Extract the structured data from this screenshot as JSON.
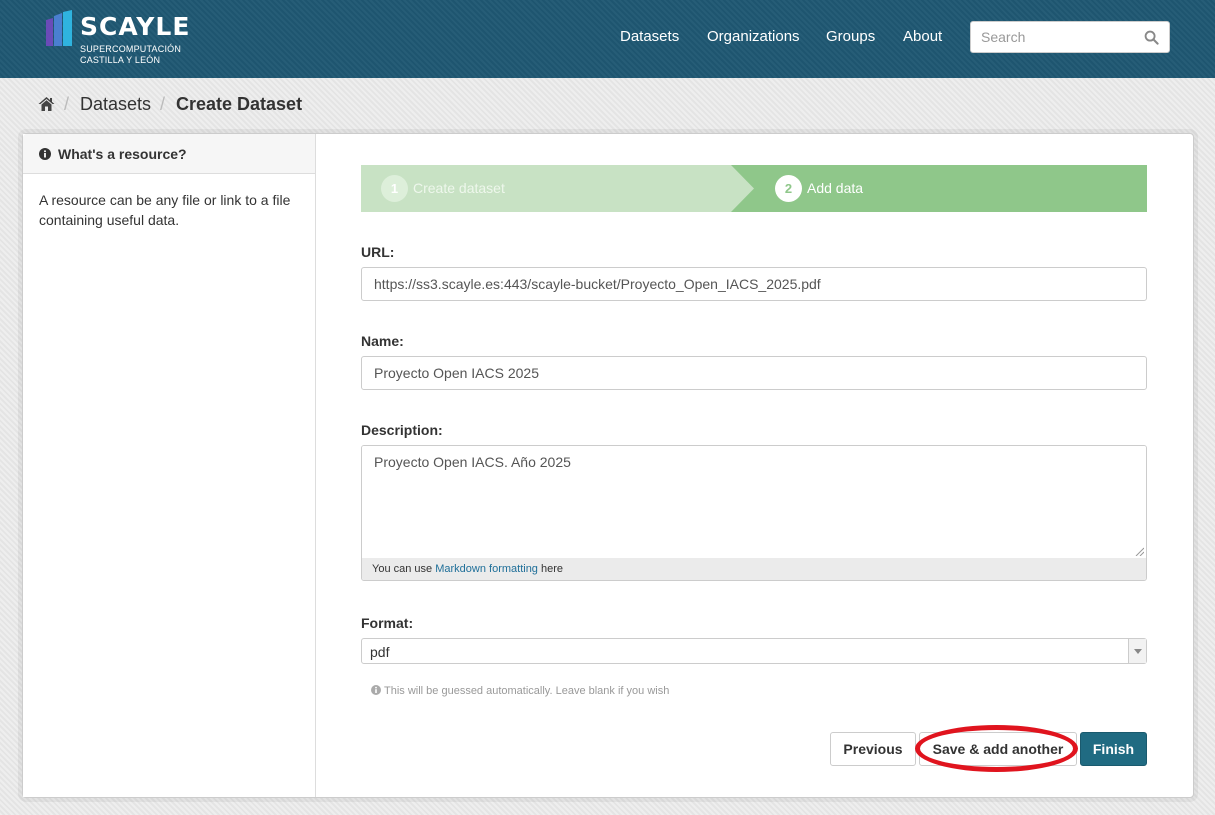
{
  "brand": {
    "name": "SCAYLE",
    "subtitle_line1": "SUPERCOMPUTACIÓN",
    "subtitle_line2": "CASTILLA Y LEÓN",
    "colors": {
      "header_bg": "#1f5873",
      "mark_left": "#5b3fa8",
      "mark_right": "#2ea8d8"
    }
  },
  "nav": {
    "items": [
      {
        "label": "Datasets"
      },
      {
        "label": "Organizations"
      },
      {
        "label": "Groups"
      },
      {
        "label": "About"
      }
    ],
    "search": {
      "placeholder": "Search",
      "icon": "search-icon"
    }
  },
  "breadcrumb": {
    "home_icon": "home-icon",
    "items": [
      {
        "label": "Datasets"
      }
    ],
    "active": "Create Dataset"
  },
  "sidebar": {
    "title": "What's a resource?",
    "icon": "info-circle-icon",
    "text": "A resource can be any file or link to a file containing useful data."
  },
  "stages": [
    {
      "number": "1",
      "label": "Create dataset",
      "state": "complete"
    },
    {
      "number": "2",
      "label": "Add data",
      "state": "active"
    }
  ],
  "form": {
    "url": {
      "label": "URL:",
      "value": "https://ss3.scayle.es:443/scayle-bucket/Proyecto_Open_IACS_2025.pdf"
    },
    "name": {
      "label": "Name:",
      "value": "Proyecto Open IACS 2025"
    },
    "description": {
      "label": "Description:",
      "value": "Proyecto Open IACS. Año 2025",
      "hint_prefix": "You can use",
      "hint_link": "Markdown formatting",
      "hint_suffix": "here"
    },
    "format": {
      "label": "Format:",
      "value": "pdf",
      "help": "This will be guessed automatically. Leave blank if you wish"
    }
  },
  "buttons": {
    "previous": "Previous",
    "save_add": "Save & add another",
    "finish": "Finish"
  },
  "colors": {
    "stage_complete": "#c8e2c4",
    "stage_active": "#8fc78a",
    "primary_button": "#206b82",
    "annotation_ring": "#e0141e",
    "link": "#1f6f99"
  }
}
